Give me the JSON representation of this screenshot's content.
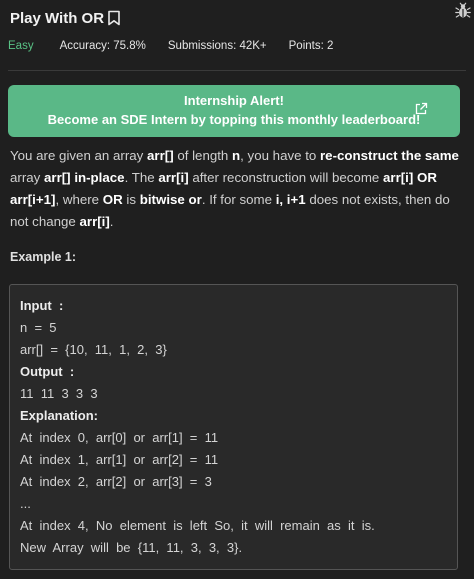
{
  "problem": {
    "title": "Play With OR",
    "difficulty": "Easy",
    "accuracy": "Accuracy: 75.8%",
    "submissions": "Submissions: 42K+",
    "points": "Points: 2"
  },
  "alert": {
    "line1": "Internship Alert!",
    "line2": "Become an SDE Intern by topping this monthly leaderboard!"
  },
  "description": {
    "t1": "You are given an array ",
    "b1": "arr[]",
    "t2": " of length ",
    "b2": "n",
    "t3": ", you have to ",
    "b3": "re-construct the same",
    "t4": " array ",
    "b4": "arr[]",
    "t5": " ",
    "b5": "in-place",
    "t6": ". The ",
    "b6": "arr[i]",
    "t7": " after reconstruction will become ",
    "b7": "arr[i] OR arr[i+1]",
    "t8": ", where ",
    "b8": "OR",
    "t9": " is ",
    "b9": "bitwise or",
    "t10": ". If for some ",
    "b10": "i, i+1",
    "t11": " does not exists, then do not change ",
    "b11": "arr[i]",
    "t12": "."
  },
  "example": {
    "title": "Example 1:",
    "lines": [
      {
        "text": "Input  :",
        "bold": true
      },
      {
        "text": "n  =  5",
        "bold": false
      },
      {
        "text": "arr[]  =  {10,  11,  1,  2,  3}",
        "bold": false
      },
      {
        "text": "Output  :",
        "bold": true
      },
      {
        "text": "11  11  3  3  3",
        "bold": false
      },
      {
        "text": "Explanation:",
        "bold": true
      },
      {
        "text": "At  index  0,  arr[0]  or  arr[1]  =  11",
        "bold": false
      },
      {
        "text": "At  index  1,  arr[1]  or  arr[2]  =  11",
        "bold": false
      },
      {
        "text": "At  index  2,  arr[2]  or  arr[3]  =  3",
        "bold": false
      },
      {
        "text": "...",
        "bold": false
      },
      {
        "text": "At  index  4,  No  element  is  left  So,  it  will  remain  as  it  is.",
        "bold": false
      },
      {
        "text": "New  Array  will  be  {11,  11,  3,  3,  3}.",
        "bold": false
      }
    ]
  },
  "colors": {
    "background": "#1f1f1f",
    "alert": "#5ab887",
    "easy": "#59c285"
  },
  "icons": [
    "bookmark-icon",
    "bug-report-icon",
    "external-link-icon"
  ]
}
